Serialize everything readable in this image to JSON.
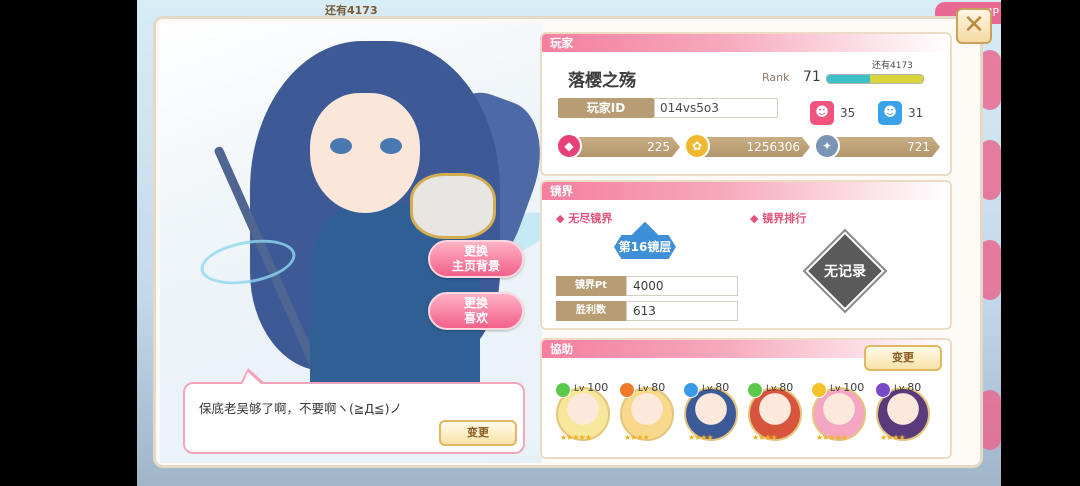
{
  "background": {
    "top_label": "还有4173",
    "tab_right": "MP"
  },
  "close_label": "✕",
  "portrait": {
    "change_bg_button": [
      "更换",
      "主页背景"
    ],
    "change_fav_button": [
      "更换",
      "喜欢"
    ]
  },
  "comment": {
    "text": "保底老吴够了啊，不要啊ヽ(≧Д≦)ノ",
    "edit_label": "变更"
  },
  "player": {
    "section_title": "玩家",
    "name": "落樱之殇",
    "rank_label": "Rank",
    "rank_value": "71",
    "exp_label": "还有4173",
    "exp_progress": 0.45,
    "id_label": "玩家ID",
    "id_value": "014vs5o3",
    "stats": [
      {
        "icon": "pink-face-icon",
        "value": "35",
        "color": "#f2537d"
      },
      {
        "icon": "blue-face-icon",
        "value": "31",
        "color": "#3aa2e8"
      }
    ],
    "resources": [
      {
        "icon": "gem-icon",
        "value": "225",
        "color": "#e8417a"
      },
      {
        "icon": "coin-icon",
        "value": "1256306",
        "color": "#f0b82e"
      },
      {
        "icon": "crystal-icon",
        "value": "721",
        "color": "#7a94b6"
      }
    ]
  },
  "mirror": {
    "section_title": "镜界",
    "endless_label": "无尽镜界",
    "ranking_label": "镜界排行",
    "floor_badge": "第16镜层",
    "pt_label": "镜界Pt",
    "pt_value": "4000",
    "wins_label": "胜利数",
    "wins_value": "613",
    "no_record": "无记录"
  },
  "support": {
    "section_title": "協助",
    "edit_label": "变更",
    "members": [
      {
        "level": "100",
        "hair": "#f6e79a",
        "attr_color": "#5bc84a",
        "stars": "★★★★★"
      },
      {
        "level": "80",
        "hair": "#f8d98b",
        "attr_color": "#f07a2a",
        "stars": "★★★★"
      },
      {
        "level": "80",
        "hair": "#3c5a98",
        "attr_color": "#3a9ae8",
        "stars": "★★★★"
      },
      {
        "level": "80",
        "hair": "#d8553d",
        "attr_color": "#5bc84a",
        "stars": "★★★★"
      },
      {
        "level": "100",
        "hair": "#f4a6c2",
        "attr_color": "#f2c32a",
        "stars": "★★★★★"
      },
      {
        "level": "80",
        "hair": "#5a3a7a",
        "attr_color": "#7a4ac8",
        "stars": "★★★★"
      }
    ]
  }
}
